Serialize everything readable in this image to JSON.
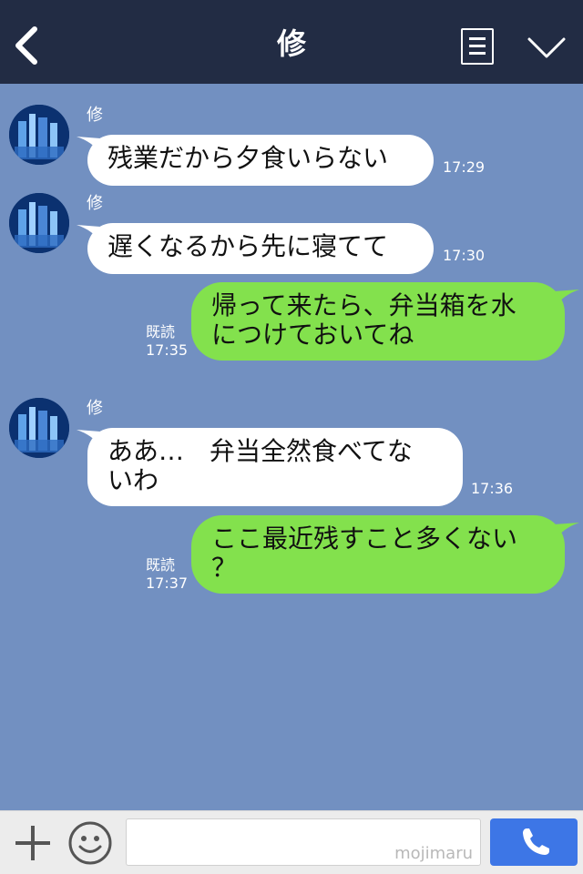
{
  "header": {
    "title": "修",
    "back_icon": "chevron-left-icon",
    "menu_icon": "notes-icon",
    "expand_icon": "chevron-down-icon"
  },
  "messages": [
    {
      "direction": "incoming",
      "sender": "修",
      "text": "残業だから夕食いらない",
      "time": "17:29"
    },
    {
      "direction": "incoming",
      "sender": "修",
      "text": "遅くなるから先に寝てて",
      "time": "17:30"
    },
    {
      "direction": "outgoing",
      "text": "帰って来たら、弁当箱を水\nにつけておいてね",
      "read_label": "既読",
      "time": "17:35"
    },
    {
      "direction": "incoming",
      "sender": "修",
      "text": "ああ…　弁当全然食べてな\nいわ",
      "time": "17:36"
    },
    {
      "direction": "outgoing",
      "text": "ここ最近残すこと多くない\n？",
      "read_label": "既読",
      "time": "17:37"
    }
  ],
  "footer": {
    "plus_icon": "plus-icon",
    "emoji_icon": "smiley-icon",
    "input_value": "",
    "watermark": "mojimaru",
    "send_icon": "phone-icon"
  },
  "colors": {
    "header_bg": "#222c44",
    "chat_bg": "#7290c1",
    "incoming_bubble": "#ffffff",
    "outgoing_bubble": "#83e14d",
    "send_button": "#3d76e6"
  }
}
